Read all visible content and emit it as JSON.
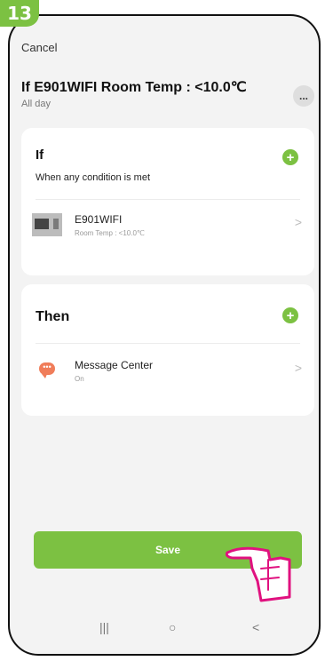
{
  "step_badge": "13",
  "header": {
    "cancel_label": "Cancel",
    "title": "If E901WIFI Room Temp : <10.0℃",
    "subtitle": "All day",
    "more_label": "..."
  },
  "if_card": {
    "heading": "If",
    "condition": "When any condition is met",
    "add_label": "+",
    "condition_item": {
      "title": "E901WIFI",
      "subtitle": "Room Temp : <10.0℃",
      "arrow": ">",
      "icon": "thermostat-device-icon"
    }
  },
  "then_card": {
    "heading": "Then",
    "add_label": "+",
    "action_item": {
      "title": "Message Center",
      "subtitle": "On",
      "arrow": ">",
      "icon": "message-bubble-icon",
      "icon_glyph": "•••"
    }
  },
  "save_label": "Save",
  "nav": {
    "recent": "|||",
    "home": "○",
    "back": "<"
  },
  "colors": {
    "accent": "#7cc142",
    "message_icon": "#f07d5a",
    "pointer": "#e0117f"
  }
}
